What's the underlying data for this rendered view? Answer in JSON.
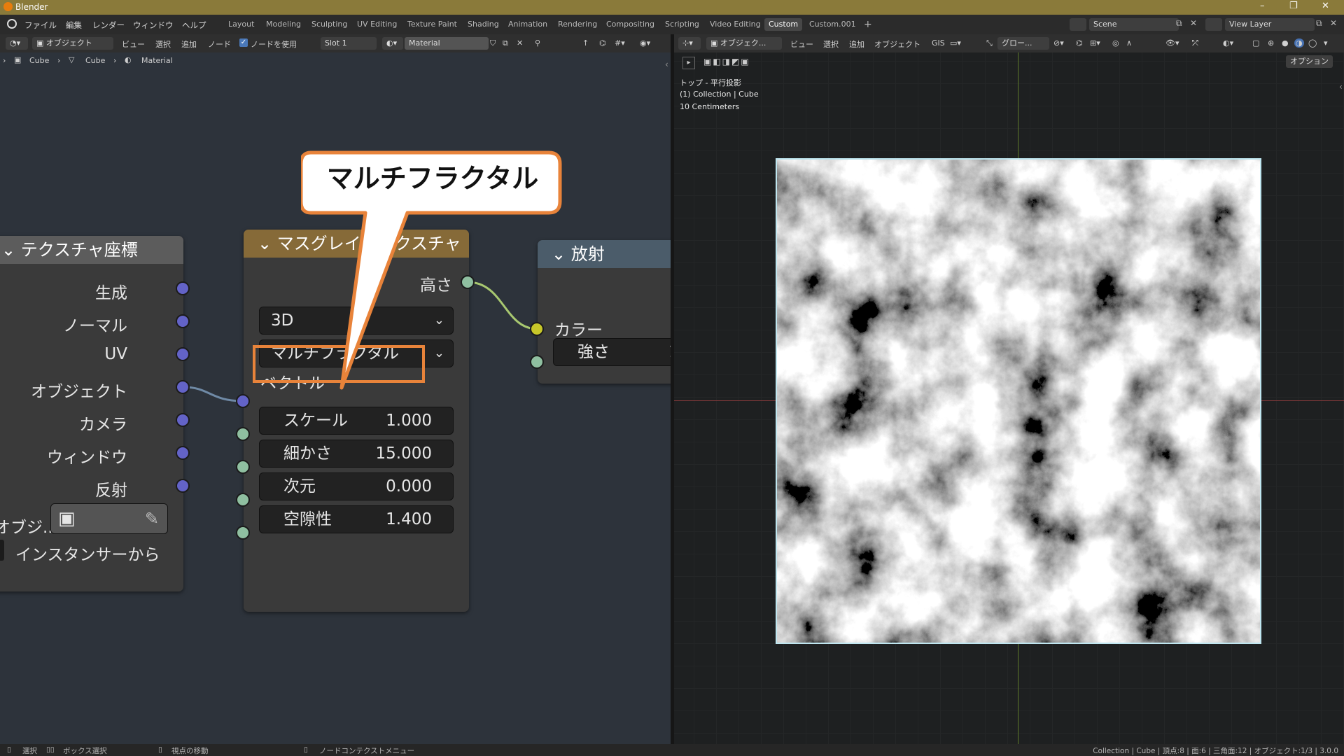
{
  "titlebar": {
    "title": "Blender",
    "minimize": "–",
    "maximize": "❐",
    "close": "✕"
  },
  "menu": {
    "items": [
      "ファイル",
      "編集",
      "レンダー",
      "ウィンドウ",
      "ヘルプ"
    ]
  },
  "workspaces": [
    "Layout",
    "Modeling",
    "Sculpting",
    "UV Editing",
    "Texture Paint",
    "Shading",
    "Animation",
    "Rendering",
    "Compositing",
    "Scripting",
    "Video Editing",
    "Custom",
    "Custom.001"
  ],
  "active_workspace": "Custom",
  "scene": {
    "name": "Scene",
    "view_layer": "View Layer"
  },
  "node_header": {
    "mode": "オブジェクト",
    "menus": [
      "ビュー",
      "選択",
      "追加",
      "ノード"
    ],
    "use_nodes_label": "ノードを使用",
    "slot": "Slot 1",
    "material": "Material"
  },
  "breadcrumb": {
    "object": "Cube",
    "mesh": "Cube",
    "material": "Material"
  },
  "texcoord_node": {
    "title": "テクスチャ座標",
    "outputs": [
      "生成",
      "ノーマル",
      "UV",
      "オブジェクト",
      "カメラ",
      "ウィンドウ",
      "反射"
    ],
    "object_label": "オブジ...",
    "instancer_label": "インスタンサーから"
  },
  "musgrave_node": {
    "title": "マスグレイブテクスチャ",
    "output_height": "高さ",
    "dimension": "3D",
    "type": "マルチフラクタル",
    "vector_label": "ベクトル",
    "fields": [
      {
        "label": "スケール",
        "value": "1.000"
      },
      {
        "label": "細かさ",
        "value": "15.000"
      },
      {
        "label": "次元",
        "value": "0.000"
      },
      {
        "label": "空隙性",
        "value": "1.400"
      }
    ]
  },
  "emission_node": {
    "title": "放射",
    "color_label": "カラー",
    "strength_label": "強さ",
    "strength_value_partial": "1"
  },
  "callout": {
    "text": "マルチフラクタル"
  },
  "vp_header": {
    "mode": "オブジェク...",
    "menus": [
      "ビュー",
      "選択",
      "追加",
      "オブジェクト",
      "GIS"
    ],
    "orientation": "グロー...",
    "options": "オプション"
  },
  "viewport_overlay": {
    "view": "トップ - 平行投影",
    "collection": "(1) Collection | Cube",
    "scale": "10 Centimeters"
  },
  "statusbar": {
    "left": [
      "選択",
      "ボックス選択",
      "視点の移動",
      "ノードコンテクストメニュー"
    ],
    "right": "Collection | Cube | 頂点:8 | 面:6 | 三角面:12 | オブジェクト:1/3 | 3.0.0"
  },
  "colors": {
    "accent": "#e8833a",
    "musgrave_header": "#866a38",
    "emission_header": "#4b5c6a",
    "input_header": "#5a3a3a"
  }
}
